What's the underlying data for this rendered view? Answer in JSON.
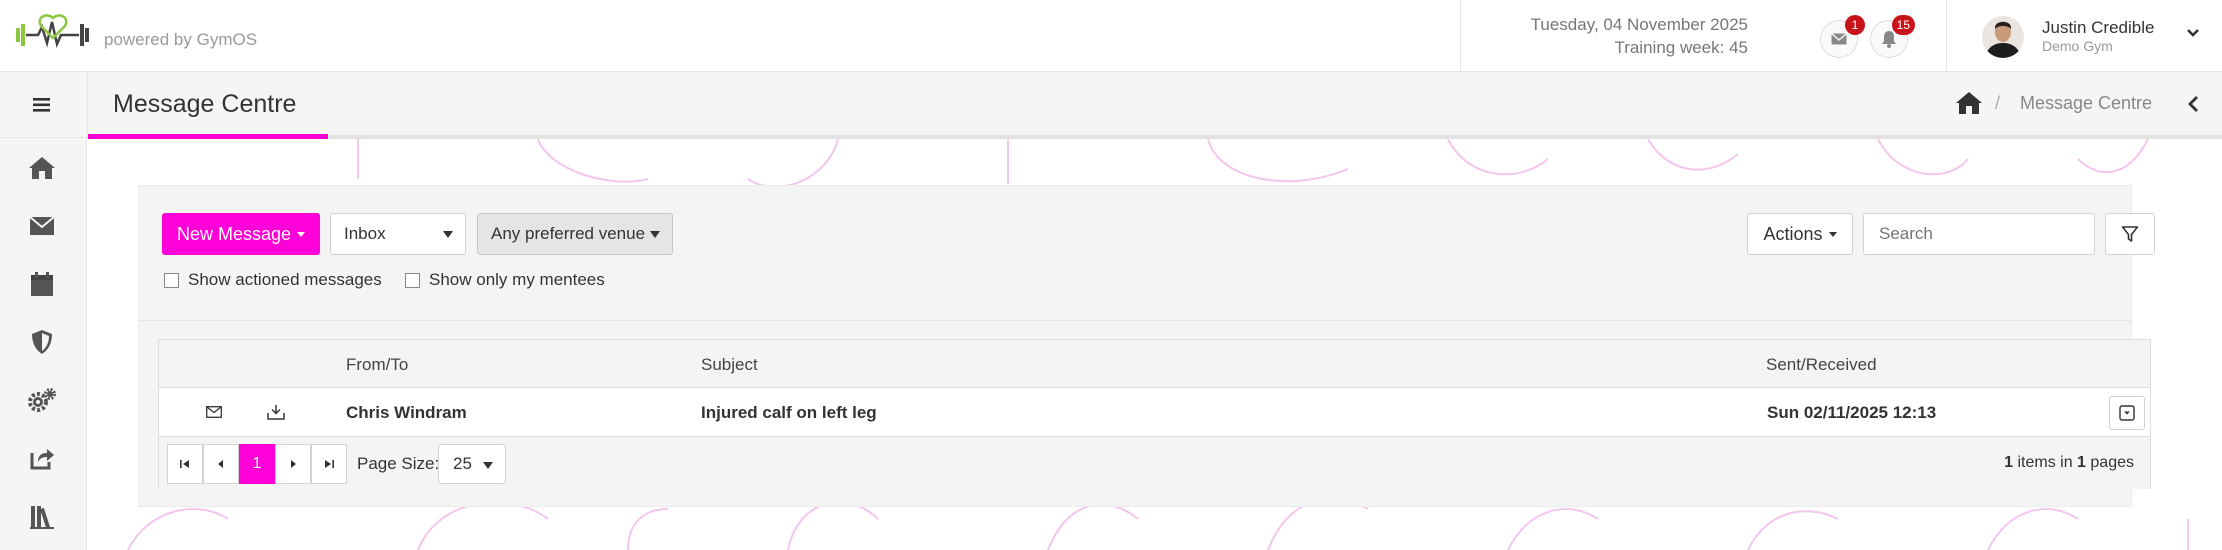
{
  "header": {
    "powered_by": "powered by GymOS",
    "date": "Tuesday, 04 November 2025",
    "training_week": "Training week: 45",
    "messages_badge": "1",
    "notifications_badge": "15",
    "user_name": "Justin Credible",
    "user_gym": "Demo Gym"
  },
  "subheader": {
    "title": "Message Centre",
    "breadcrumb_sep": "/",
    "breadcrumb_current": "Message Centre"
  },
  "sidebar": {
    "items": [
      {
        "icon": "home-icon"
      },
      {
        "icon": "envelope-icon"
      },
      {
        "icon": "calendar-icon"
      },
      {
        "icon": "shield-icon"
      },
      {
        "icon": "gears-icon"
      },
      {
        "icon": "share-icon"
      },
      {
        "icon": "library-icon"
      }
    ]
  },
  "toolbar": {
    "new_message_label": "New Message",
    "folder_value": "Inbox",
    "venue_value": "Any preferred venue",
    "show_actioned_label": "Show actioned messages",
    "show_mentees_label": "Show only my mentees",
    "actions_label": "Actions",
    "search_placeholder": "Search"
  },
  "grid": {
    "columns": {
      "from_to": "From/To",
      "subject": "Subject",
      "sent_received": "Sent/Received"
    },
    "rows": [
      {
        "from_to": "Chris Windram",
        "subject": "Injured calf on left leg",
        "sent_received": "Sun 02/11/2025 12:13"
      }
    ]
  },
  "pager": {
    "current_page": "1",
    "page_size_label": "Page Size:",
    "page_size_value": "25",
    "items_count": "1",
    "items_text": " items in ",
    "pages_count": "1",
    "pages_text": " pages"
  },
  "colors": {
    "accent": "#ff00d8",
    "badge": "#c9131a",
    "logo_green": "#8dc63f"
  }
}
